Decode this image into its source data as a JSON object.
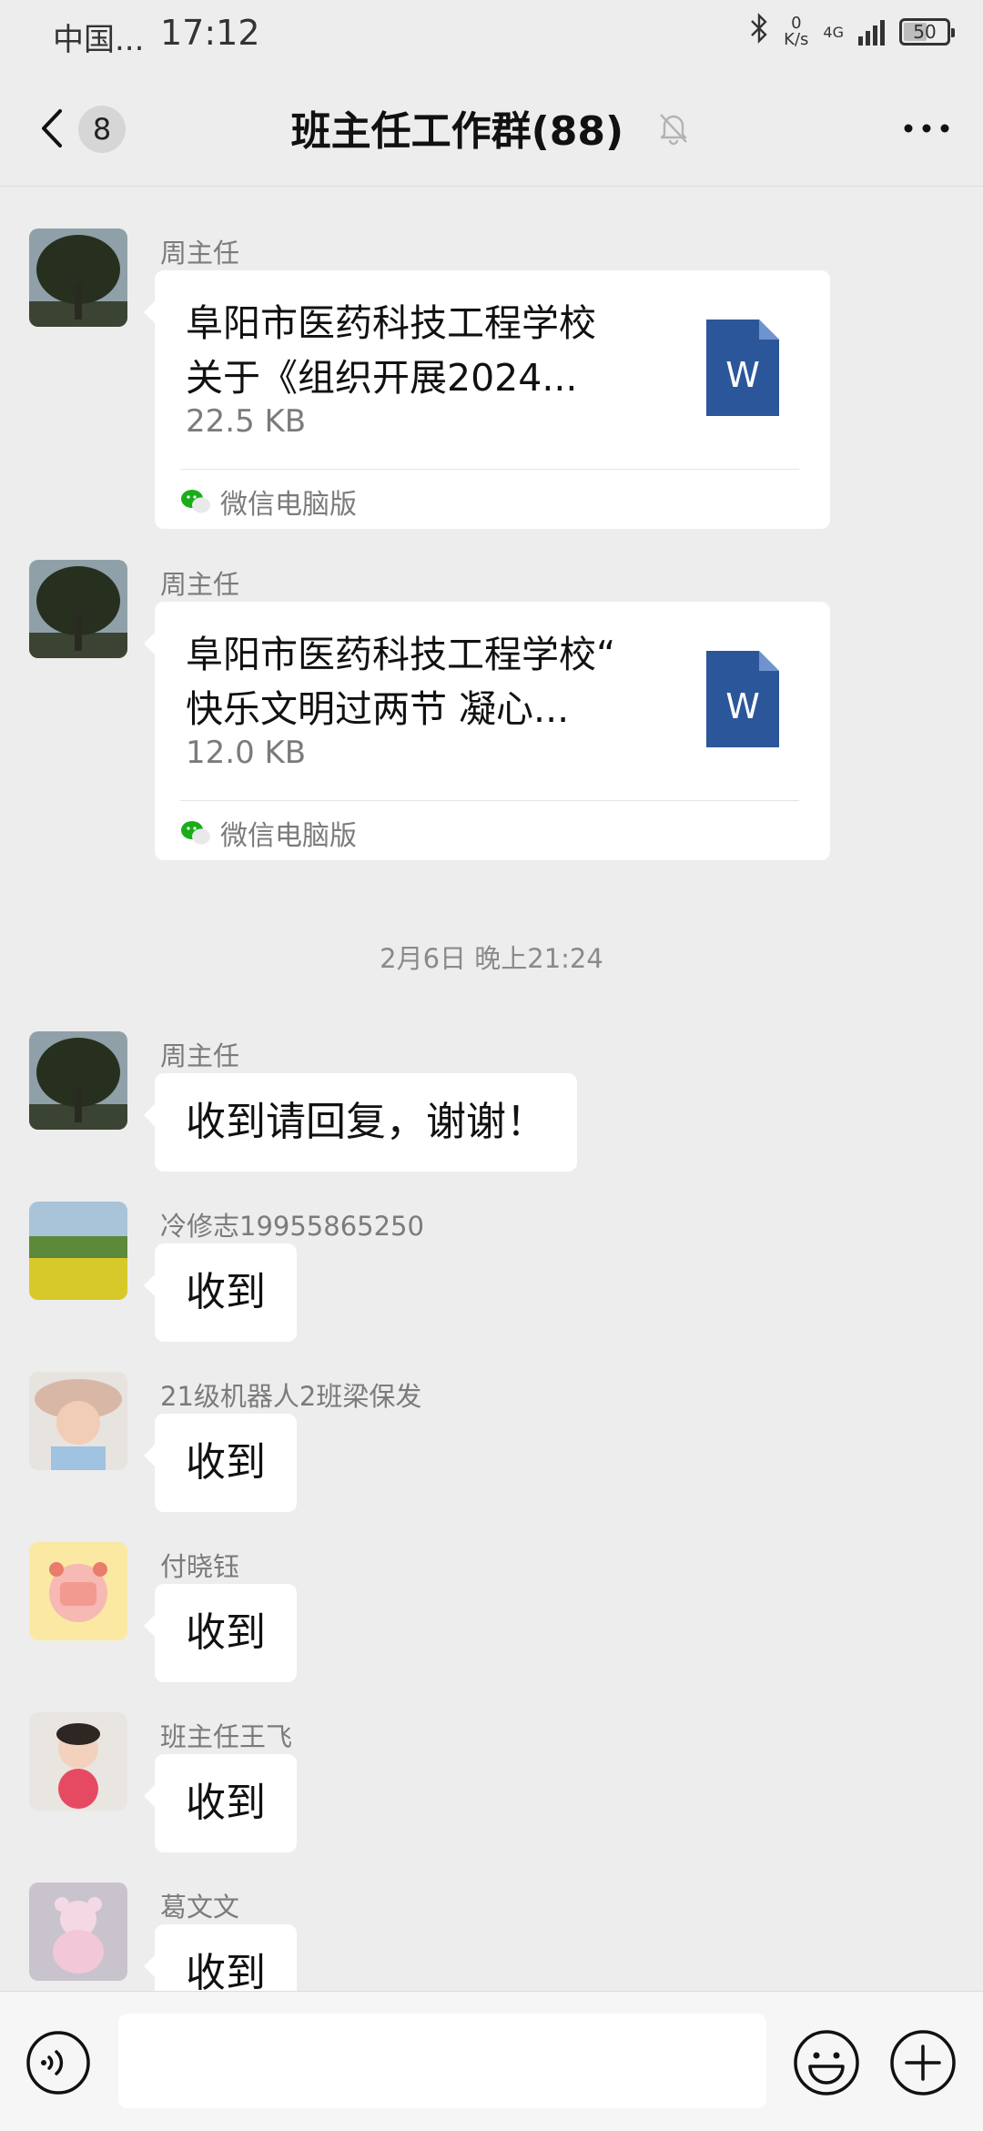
{
  "status_bar": {
    "carrier": "中国...",
    "time": "17:12",
    "net_speed_value": "0",
    "net_speed_unit": "K/s",
    "signal_label": "4G",
    "battery": "50"
  },
  "nav": {
    "unread_count": "8",
    "title": "班主任工作群(88)"
  },
  "messages": [
    {
      "sender": "周主任",
      "file": {
        "title_line1": "阜阳市医药科技工程学校",
        "title_line2": "关于《组织开展2024...",
        "size": "22.5 KB",
        "source": "微信电脑版"
      }
    },
    {
      "sender": "周主任",
      "file": {
        "title_line1": "阜阳市医药科技工程学校“",
        "title_line2": "快乐文明过两节 凝心...",
        "size": "12.0 KB",
        "source": "微信电脑版"
      }
    },
    {
      "sender": "周主任",
      "text": "收到请回复，谢谢！"
    },
    {
      "sender": "冷修志19955865250",
      "text": "收到"
    },
    {
      "sender": "21级机器人2班梁保发",
      "text": "收到"
    },
    {
      "sender": "付晓钰",
      "text": "收到"
    },
    {
      "sender": "班主任王飞",
      "text": "收到"
    },
    {
      "sender": "葛文文",
      "text": "收到"
    }
  ],
  "timestamp": "2月6日 晚上21:24",
  "input": {
    "value": "",
    "placeholder": ""
  },
  "colors": {
    "background": "#ededed",
    "bubble": "#ffffff",
    "word_icon": "#2b579a",
    "wechat_green": "#1aad19"
  }
}
